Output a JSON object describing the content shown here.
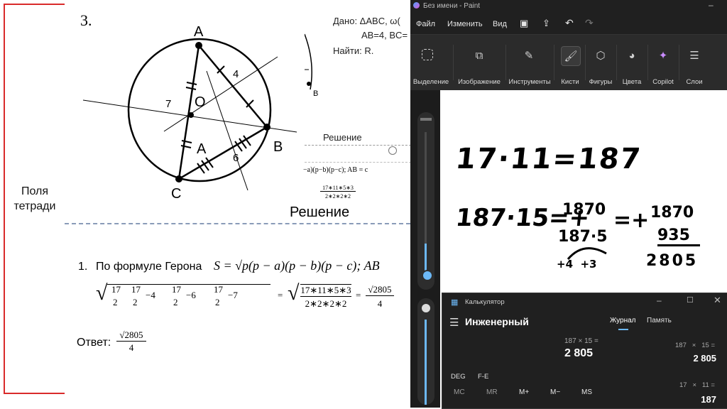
{
  "margin_label": "Поля\nтетради",
  "slide": {
    "problem_number": "3.",
    "given": "Дано: ΔABC, ω(",
    "given_sides": "AB=4, BC=",
    "find": "Найти: R.",
    "labels": {
      "A": "A",
      "B": "B",
      "C": "C",
      "O": "O",
      "A2": "A",
      "side4": "4",
      "side6": "6",
      "side7": "7",
      "B_small": "B"
    },
    "solution_title_small": "Решение",
    "solution_title": "Решение",
    "heron_item": "1.",
    "heron_text": "По формуле Герона",
    "heron_formula": "S = √p(p − a)(p − b)(p − c); AB",
    "small_formula": "−a)(p−b)(p−c); AB = c",
    "small_frac_num": "17∗11∗5∗3",
    "small_frac_den": "2∗2∗2∗2",
    "calc_line": {
      "a": "17",
      "b": "2",
      "term1": "−4",
      "term2": "−6",
      "term3": "−7",
      "eq": "=",
      "num": "17∗11∗5∗3",
      "den": "2∗2∗2∗2",
      "res_num": "√2805",
      "res_den": "4"
    },
    "answer_label": "Ответ:",
    "answer_num": "√2805",
    "answer_den": "4"
  },
  "paint": {
    "title": "Без имени - Paint",
    "menu": [
      "Файл",
      "Изменить",
      "Вид"
    ],
    "ribbon": [
      {
        "label": "Выделение",
        "icon": "selection-icon"
      },
      {
        "label": "Изображение",
        "icon": "image-icon"
      },
      {
        "label": "Инструменты",
        "icon": "tools-icon"
      },
      {
        "label": "Кисти",
        "icon": "brush-icon"
      },
      {
        "label": "Фигуры",
        "icon": "shapes-icon"
      },
      {
        "label": "Цвета",
        "icon": "palette-icon"
      },
      {
        "label": "Copilot",
        "icon": "copilot-icon"
      },
      {
        "label": "Слои",
        "icon": "layers-icon"
      }
    ],
    "handwriting": {
      "line1": "17·11=187",
      "line2_left": "187·15=+",
      "line2_top": "1870",
      "line2_bottom": "187·5",
      "line2_sub": "+4  +3",
      "line3_eq": "=+",
      "line3_top": "1870",
      "line3_mid": "935",
      "line3_result": "2805"
    }
  },
  "calculator": {
    "title": "Калькулятор",
    "mode": "Инженерный",
    "tab_history": "Журнал",
    "tab_memory": "Память",
    "expression": "187 × 15 =",
    "display": "2 805",
    "angle": "DEG",
    "fe": "F-E",
    "memory_buttons": [
      "MC",
      "MR",
      "M+",
      "M−",
      "MS"
    ],
    "history": [
      {
        "expr": "187   ×   15 =",
        "result": "2 805"
      },
      {
        "expr": "17   ×   11 =",
        "result": "187"
      }
    ],
    "accent": "#6cb8f6"
  }
}
